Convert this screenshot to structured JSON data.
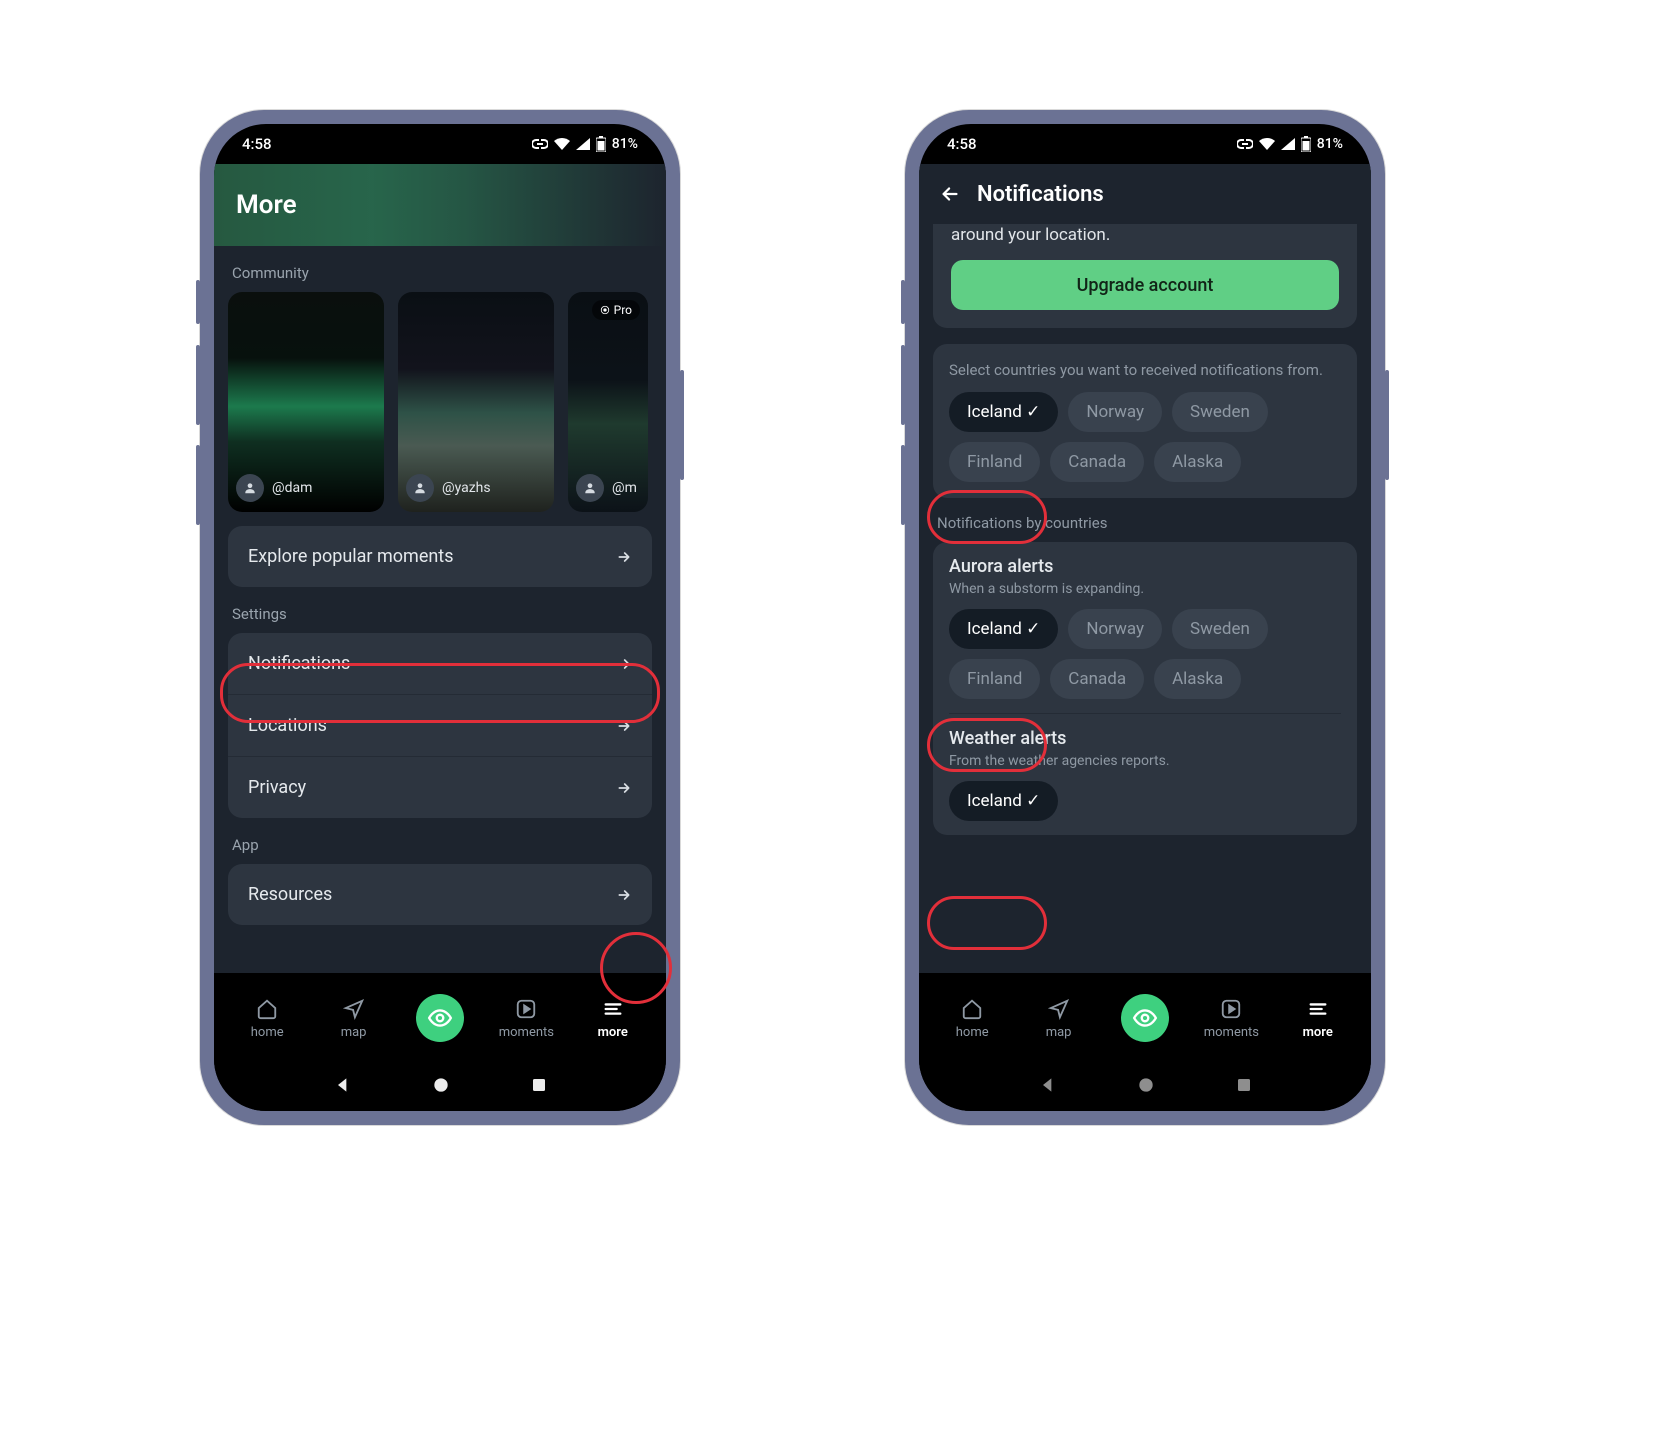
{
  "status": {
    "time": "4:58",
    "battery": "81%"
  },
  "left": {
    "title": "More",
    "community_label": "Community",
    "moments": [
      {
        "user": "@dam",
        "pro": false
      },
      {
        "user": "@yazhs",
        "pro": false
      },
      {
        "user": "@m",
        "pro": true,
        "pro_label": "Pro"
      }
    ],
    "explore_label": "Explore popular moments",
    "settings_label": "Settings",
    "settings_items": [
      {
        "label": "Notifications"
      },
      {
        "label": "Locations"
      },
      {
        "label": "Privacy"
      }
    ],
    "app_label": "App",
    "app_items": [
      {
        "label": "Resources"
      }
    ]
  },
  "right": {
    "title": "Notifications",
    "upgrade_tail": "around your location.",
    "upgrade_button": "Upgrade account",
    "select_countries_text": "Select countries you want to received notifications from.",
    "countries": [
      "Iceland",
      "Norway",
      "Sweden",
      "Finland",
      "Canada",
      "Alaska"
    ],
    "selected_country": "Iceland",
    "notif_by_countries_label": "Notifications by countries",
    "aurora": {
      "title": "Aurora alerts",
      "sub": "When a substorm is expanding.",
      "countries": [
        "Iceland",
        "Norway",
        "Sweden",
        "Finland",
        "Canada",
        "Alaska"
      ],
      "selected": "Iceland"
    },
    "weather": {
      "title": "Weather alerts",
      "sub": "From the weather agencies reports.",
      "countries": [
        "Iceland"
      ],
      "selected": "Iceland"
    }
  },
  "tabs": {
    "items": [
      {
        "key": "home",
        "label": "home"
      },
      {
        "key": "map",
        "label": "map"
      },
      {
        "key": "fab",
        "label": ""
      },
      {
        "key": "moments",
        "label": "moments"
      },
      {
        "key": "more",
        "label": "more"
      }
    ],
    "active": "more"
  }
}
